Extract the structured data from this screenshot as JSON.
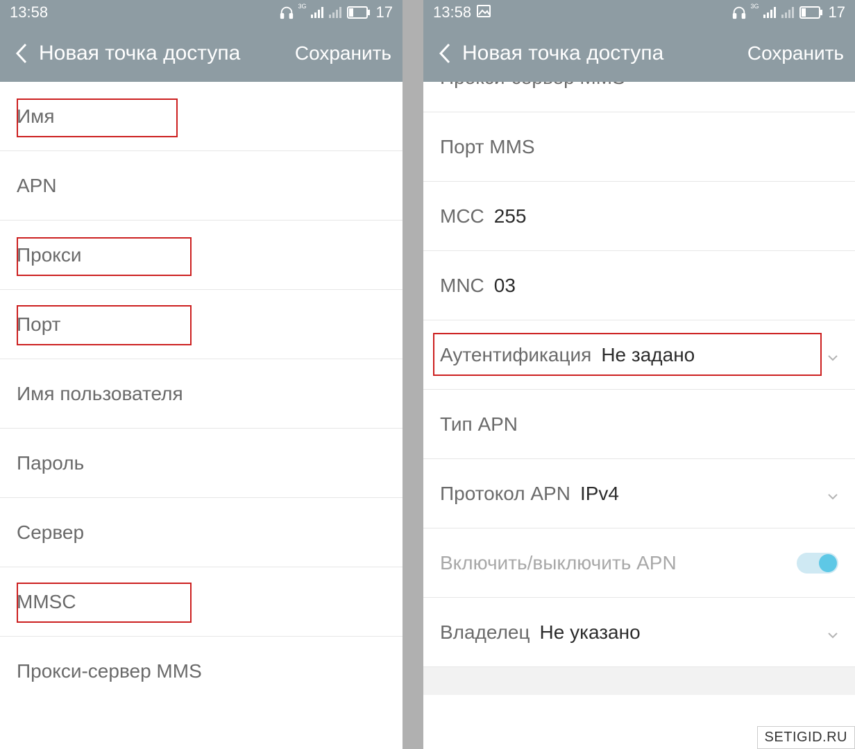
{
  "statusbar": {
    "time": "13:58",
    "battery_text": "17"
  },
  "header": {
    "title": "Новая точка доступа",
    "save_label": "Сохранить"
  },
  "left_screen": {
    "rows": [
      {
        "label": "Имя"
      },
      {
        "label": "APN"
      },
      {
        "label": "Прокси"
      },
      {
        "label": "Порт"
      },
      {
        "label": "Имя пользователя"
      },
      {
        "label": "Пароль"
      },
      {
        "label": "Сервер"
      },
      {
        "label": "MMSC"
      },
      {
        "label": "Прокси-сервер MMS"
      }
    ]
  },
  "right_screen": {
    "clipped_label": "Прокси-сервер MMS",
    "rows": [
      {
        "label": "Порт MMS",
        "value": ""
      },
      {
        "label": "MCC",
        "value": "255"
      },
      {
        "label": "MNC",
        "value": "03"
      },
      {
        "label": "Аутентификация",
        "value": "Не задано",
        "dropdown": true,
        "highlight": true
      },
      {
        "label": "Тип APN",
        "value": ""
      },
      {
        "label": "Протокол APN",
        "value": "IPv4",
        "dropdown": true
      },
      {
        "label": "Включить/выключить APN",
        "toggle": true
      },
      {
        "label": "Владелец",
        "value": "Не указано",
        "dropdown": true
      }
    ]
  },
  "watermark": "SETIGID.RU"
}
